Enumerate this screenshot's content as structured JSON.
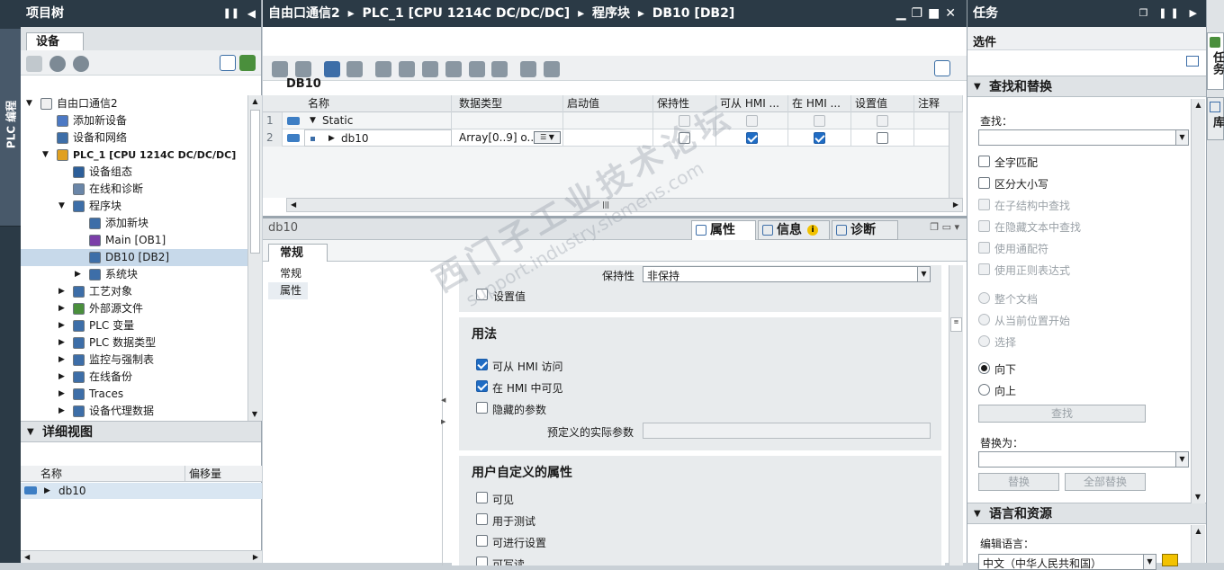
{
  "left_strip": {
    "label": "PLC 编程"
  },
  "right_strip": {
    "tabs": [
      "任务",
      "库"
    ]
  },
  "project_tree": {
    "title": "项目树",
    "tab": "设备",
    "items": [
      {
        "label": "自由口通信2",
        "level": 0,
        "expanded": true
      },
      {
        "label": "添加新设备",
        "level": 1
      },
      {
        "label": "设备和网络",
        "level": 1
      },
      {
        "label": "PLC_1 [CPU 1214C DC/DC/DC]",
        "level": 1,
        "expanded": true
      },
      {
        "label": "设备组态",
        "level": 2
      },
      {
        "label": "在线和诊断",
        "level": 2
      },
      {
        "label": "程序块",
        "level": 2,
        "expanded": true
      },
      {
        "label": "添加新块",
        "level": 3
      },
      {
        "label": "Main [OB1]",
        "level": 3
      },
      {
        "label": "DB10 [DB2]",
        "level": 3,
        "selected": true
      },
      {
        "label": "系统块",
        "level": 3,
        "collapsed": true
      },
      {
        "label": "工艺对象",
        "level": 2,
        "collapsed": true
      },
      {
        "label": "外部源文件",
        "level": 2,
        "collapsed": true
      },
      {
        "label": "PLC 变量",
        "level": 2,
        "collapsed": true
      },
      {
        "label": "PLC 数据类型",
        "level": 2,
        "collapsed": true
      },
      {
        "label": "监控与强制表",
        "level": 2,
        "collapsed": true
      },
      {
        "label": "在线备份",
        "level": 2,
        "collapsed": true
      },
      {
        "label": "Traces",
        "level": 2,
        "collapsed": true
      },
      {
        "label": "设备代理数据",
        "level": 2,
        "collapsed": true
      }
    ]
  },
  "detail_view": {
    "title": "详细视图",
    "col_name": "名称",
    "col_offset": "偏移量",
    "row": "db10"
  },
  "editor": {
    "breadcrumb": [
      "自由口通信2",
      "PLC_1 [CPU 1214C DC/DC/DC]",
      "程序块",
      "DB10 [DB2]"
    ],
    "block_name": "DB10",
    "columns": [
      "名称",
      "数据类型",
      "启动值",
      "保持性",
      "可从 HMI ...",
      "在 HMI ...",
      "设置值",
      "注释"
    ],
    "rows": [
      {
        "num": "1",
        "name": "Static",
        "type": "",
        "retain": false,
        "hmi_access": false,
        "hmi_visible": false,
        "setpoint": false
      },
      {
        "num": "2",
        "name": "db10",
        "type": "Array[0..9] o...",
        "retain": false,
        "hmi_access": true,
        "hmi_visible": true,
        "setpoint": false
      }
    ]
  },
  "properties": {
    "object_name": "db10",
    "tabs": [
      "属性",
      "信息",
      "诊断"
    ],
    "subtab": "常规",
    "nav": [
      "常规",
      "属性"
    ],
    "retain_label": "保持性",
    "retain_value": "非保持",
    "setpoint_label": "设置值",
    "usage_title": "用法",
    "hmi_access_label": "可从 HMI 访问",
    "hmi_visible_label": "在 HMI 中可见",
    "hidden_param_label": "隐藏的参数",
    "predefined_label": "预定义的实际参数",
    "user_attr_title": "用户自定义的属性",
    "user_attrs": [
      "可见",
      "用于测试",
      "可进行设置",
      "可写读"
    ]
  },
  "tasks": {
    "title": "任务",
    "options_label": "选件",
    "find_replace_title": "查找和替换",
    "find_label": "查找：",
    "options": [
      {
        "label": "全字匹配",
        "enabled": true
      },
      {
        "label": "区分大小写",
        "enabled": true
      },
      {
        "label": "在子结构中查找",
        "enabled": false
      },
      {
        "label": "在隐藏文本中查找",
        "enabled": false
      },
      {
        "label": "使用通配符",
        "enabled": false
      },
      {
        "label": "使用正则表达式",
        "enabled": false
      }
    ],
    "scope": [
      {
        "label": "整个文档",
        "enabled": false
      },
      {
        "label": "从当前位置开始",
        "enabled": false
      },
      {
        "label": "选择",
        "enabled": false
      }
    ],
    "direction": [
      {
        "label": "向下",
        "selected": true
      },
      {
        "label": "向上",
        "selected": false
      }
    ],
    "find_button": "查找",
    "replace_label": "替换为：",
    "replace_button": "替换",
    "replace_all_button": "全部替换",
    "lang_title": "语言和资源",
    "edit_lang_label": "编辑语言：",
    "edit_lang_value": "中文（中华人民共和国）"
  },
  "watermark": [
    "西门子工业技术论坛",
    "support.industry.siemens.com"
  ],
  "colors": {
    "header": "#2b3a46",
    "accent": "#1f6cc4",
    "selection": "#c7d9ea"
  }
}
